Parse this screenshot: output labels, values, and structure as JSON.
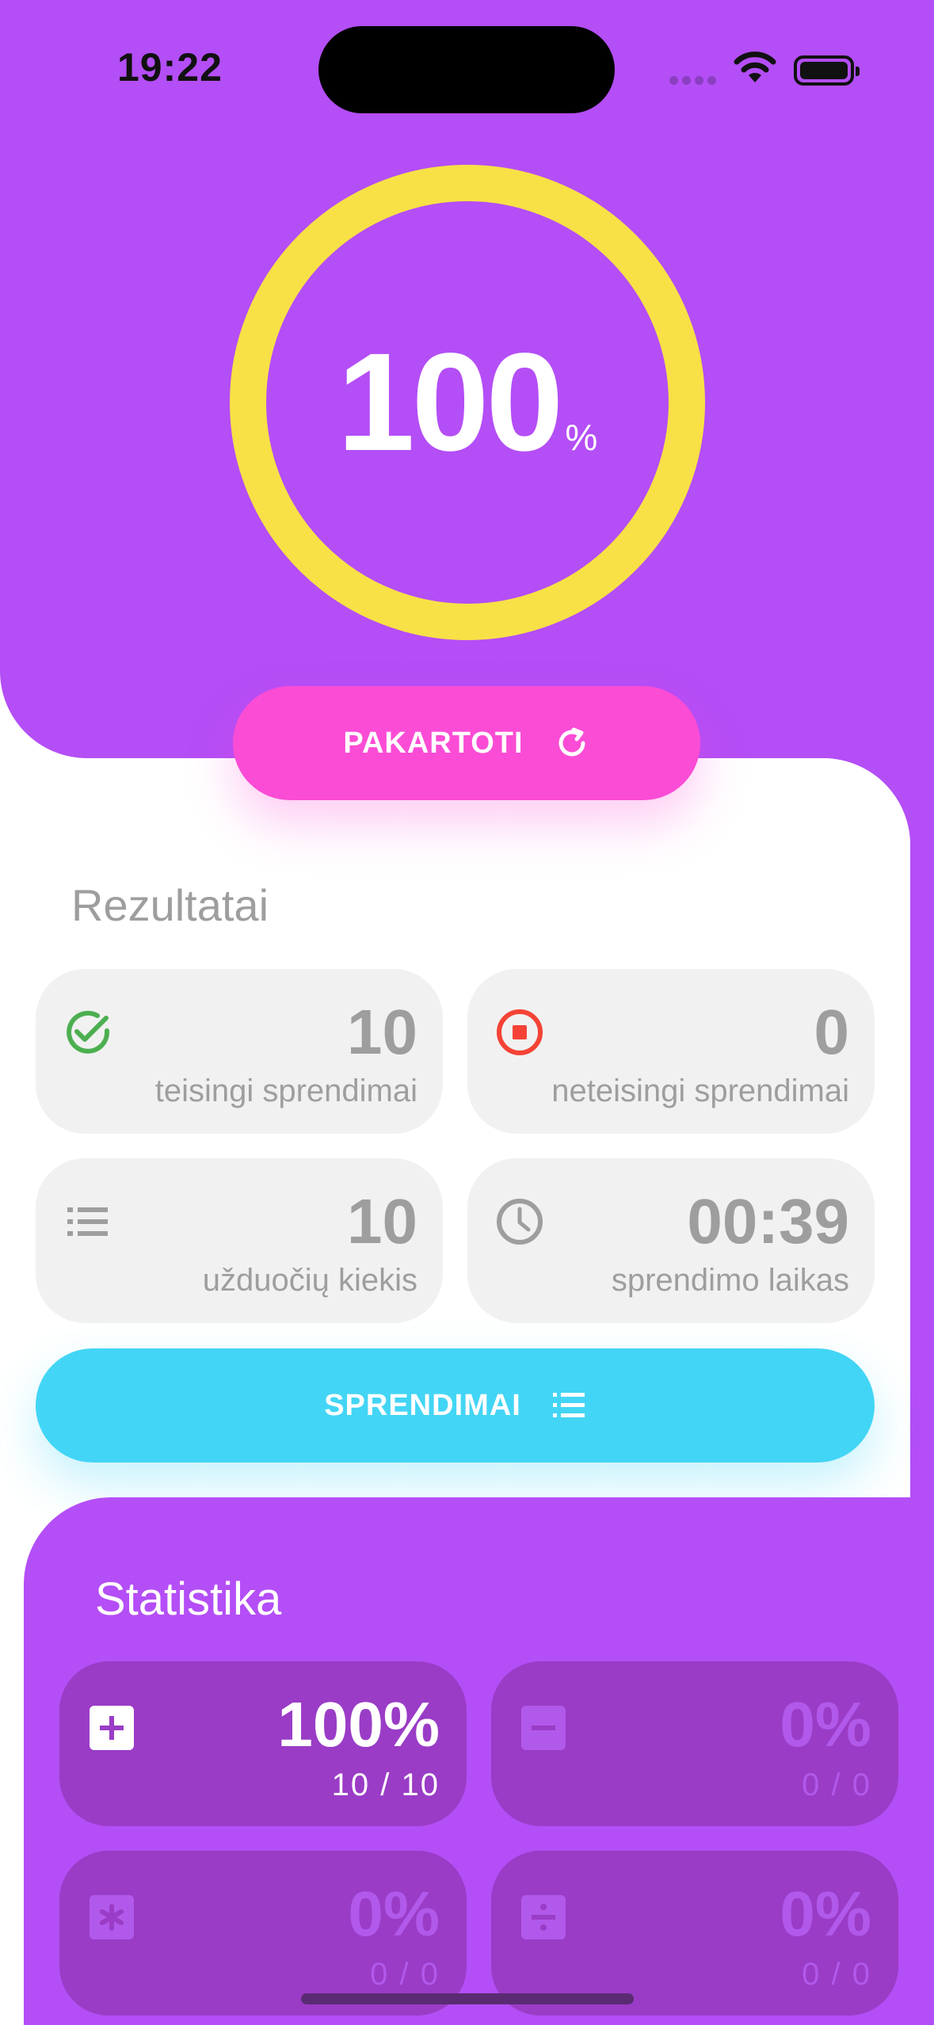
{
  "status_bar": {
    "time": "19:22"
  },
  "score": {
    "value": "100",
    "unit": "%",
    "progress": 1.0
  },
  "buttons": {
    "repeat_label": "PAKARTOTI",
    "solutions_label": "SPRENDIMAI"
  },
  "results": {
    "title": "Rezultatai",
    "cards": [
      {
        "value": "10",
        "label": "teisingi sprendimai",
        "icon": "check-circle-icon",
        "color": "#4caf50"
      },
      {
        "value": "0",
        "label": "neteisingi sprendimai",
        "icon": "stop-circle-icon",
        "color": "#f44336"
      },
      {
        "value": "10",
        "label": "užduočių kiekis",
        "icon": "list-icon",
        "color": "#9e9e9e"
      },
      {
        "value": "00:39",
        "label": "sprendimo laikas",
        "icon": "clock-icon",
        "color": "#9e9e9e"
      }
    ]
  },
  "statistics": {
    "title": "Statistika",
    "cards": [
      {
        "op": "addition",
        "icon": "plus-box-icon",
        "percent": "100%",
        "fraction": "10 / 10",
        "active": true
      },
      {
        "op": "subtraction",
        "icon": "minus-box-icon",
        "percent": "0%",
        "fraction": "0 / 0",
        "active": false
      },
      {
        "op": "multiplication",
        "icon": "asterisk-box-icon",
        "percent": "0%",
        "fraction": "0 / 0",
        "active": false
      },
      {
        "op": "division",
        "icon": "divide-box-icon",
        "percent": "0%",
        "fraction": "0 / 0",
        "active": false
      }
    ]
  },
  "colors": {
    "primary": "#b44ef6",
    "ring": "#f7e146",
    "repeat_button": "#fb4cd5",
    "solutions_button": "#43d5f5"
  }
}
